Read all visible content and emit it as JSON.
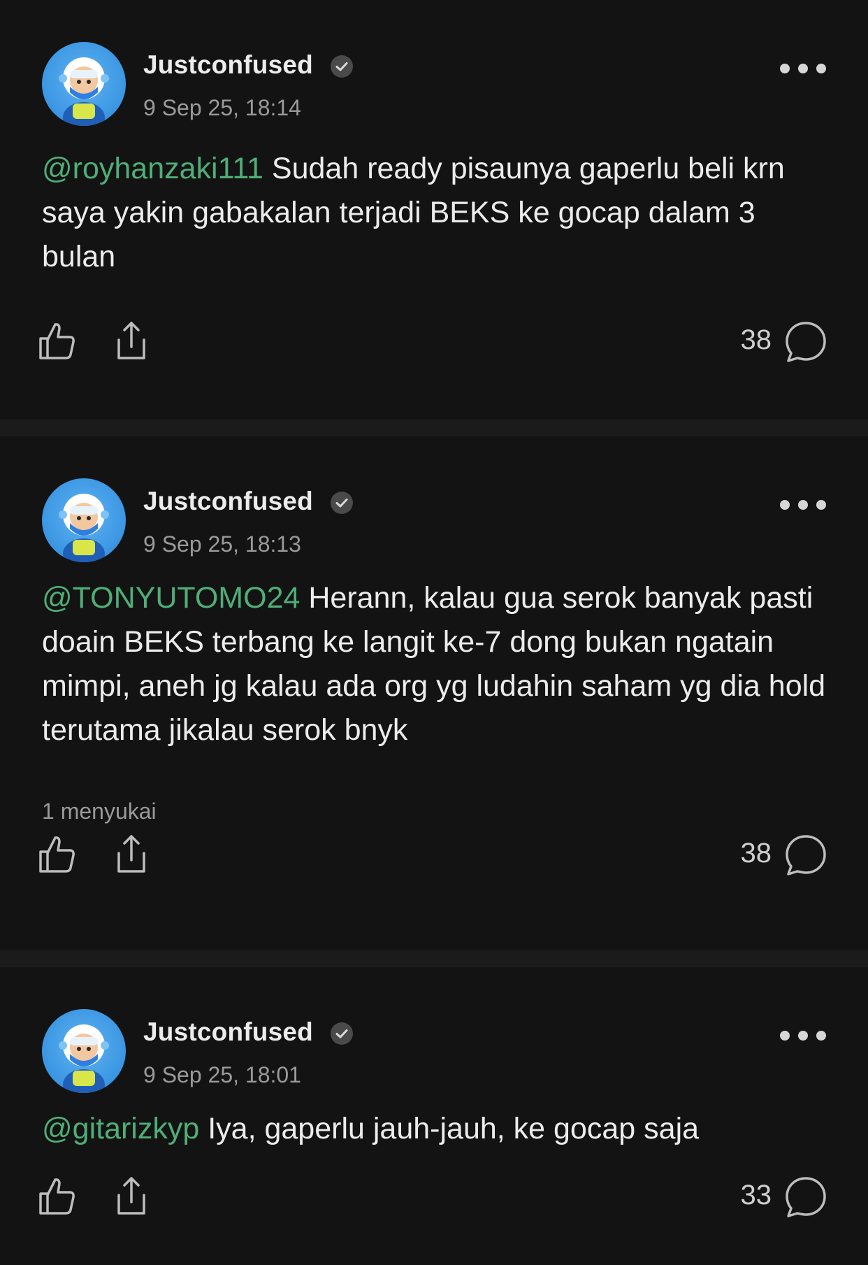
{
  "posts": [
    {
      "author": "Justconfused",
      "timestamp": "9 Sep 25, 18:14",
      "mention": "@royhanzaki111",
      "text": " Sudah ready pisaunya gaperlu beli krn saya yakin gabakalan terjadi BEKS ke gocap dalam 3 bulan",
      "likes_summary": "",
      "comment_count": "38"
    },
    {
      "author": "Justconfused",
      "timestamp": "9 Sep 25, 18:13",
      "mention": "@TONYUTOMO24",
      "text": " Herann, kalau gua serok banyak pasti doain BEKS terbang ke langit ke-7 dong bukan ngatain mimpi, aneh jg kalau ada org yg ludahin saham yg dia hold terutama jikalau serok bnyk",
      "likes_summary": "1 menyukai",
      "comment_count": "38"
    },
    {
      "author": "Justconfused",
      "timestamp": "9 Sep 25, 18:01",
      "mention": "@gitarizkyp",
      "text": " Iya, gaperlu jauh-jauh, ke gocap saja",
      "likes_summary": "",
      "comment_count": "33"
    }
  ],
  "icons": {
    "like": "thumbs-up-icon",
    "share": "share-icon",
    "comment": "comment-bubble-icon",
    "more": "more-options-icon",
    "verified": "verified-badge-icon"
  },
  "colors": {
    "background": "#131313",
    "separator": "#1b1b1b",
    "mention": "#4fae77",
    "text": "#ececec",
    "muted": "#9a9a9a"
  }
}
